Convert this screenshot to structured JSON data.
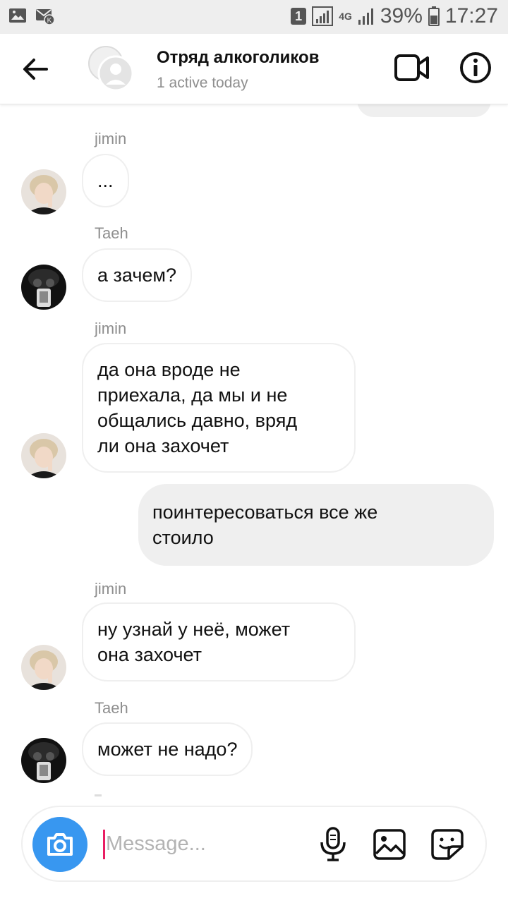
{
  "status_bar": {
    "sim_slot": "1",
    "network": "4G",
    "battery": "39%",
    "time": "17:27"
  },
  "header": {
    "title": "Отряд алкоголиков",
    "subtitle": "1 active today"
  },
  "messages": [
    {
      "sender": "jimin",
      "text": "..."
    },
    {
      "sender": "Taeh",
      "text": "а зачем?"
    },
    {
      "sender": "jimin",
      "lines": [
        "да она вроде не",
        "приехала, да мы и не",
        "общались давно, вряд",
        "ли она захочет"
      ]
    },
    {
      "outgoing": true,
      "lines": [
        "поинтересоваться все же",
        "стоило"
      ]
    },
    {
      "sender": "jimin",
      "lines": [
        "ну узнай у неё, может",
        "она захочет"
      ]
    },
    {
      "sender": "Taeh",
      "text": "может не надо?"
    }
  ],
  "composer": {
    "placeholder": "Message..."
  },
  "icons": {
    "back": "arrow-left-icon",
    "video": "video-camera-icon",
    "info": "info-icon",
    "camera": "camera-icon",
    "mic": "microphone-icon",
    "gallery": "image-icon",
    "sticker": "sticker-icon"
  },
  "colors": {
    "accent": "#3897f0",
    "caret": "#e91e63",
    "bubble_out": "#efefef",
    "meta_text": "#8e8e8e"
  }
}
